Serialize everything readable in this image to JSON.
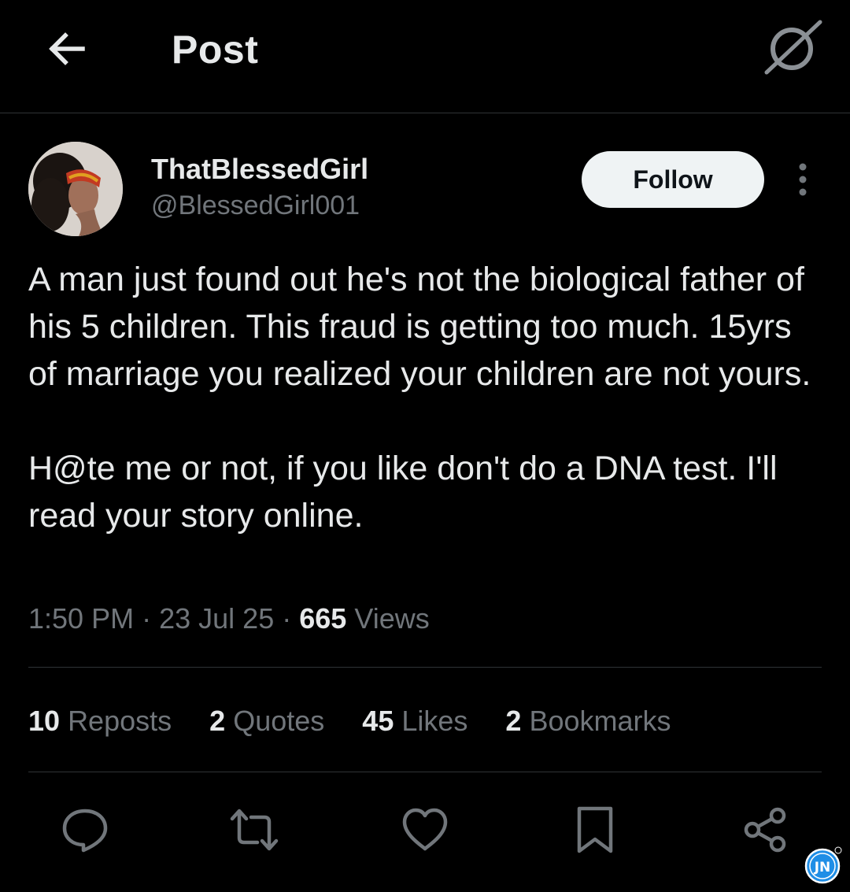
{
  "header": {
    "title": "Post",
    "back_icon": "arrow-left-icon",
    "grok_icon": "grok-icon"
  },
  "author": {
    "display_name": "ThatBlessedGirl",
    "handle": "@BlessedGirl001",
    "follow_label": "Follow",
    "more_icon": "more-vertical-icon"
  },
  "post": {
    "paragraphs": [
      "A man just found out he's not the biological father of his 5 children. This fraud is getting too much. 15yrs of marriage you realized your children are not yours.",
      "H@te me or not, if you like don't do a DNA test. I'll read your story online."
    ],
    "time": "1:50 PM",
    "separator": "·",
    "date": "23 Jul 25",
    "views_count": "665",
    "views_label": "Views"
  },
  "stats": [
    {
      "count": "10",
      "label": "Reposts"
    },
    {
      "count": "2",
      "label": "Quotes"
    },
    {
      "count": "45",
      "label": "Likes"
    },
    {
      "count": "2",
      "label": "Bookmarks"
    }
  ],
  "actions": [
    "reply-icon",
    "repost-icon",
    "like-icon",
    "bookmark-icon",
    "share-icon"
  ],
  "colors": {
    "background": "#000000",
    "primary_text": "#e7e9ea",
    "secondary_text": "#71767b",
    "divider": "#2f3336",
    "follow_bg": "#eff3f4",
    "watermark": "#1f8ee6"
  },
  "watermark": {
    "text": "JN"
  }
}
